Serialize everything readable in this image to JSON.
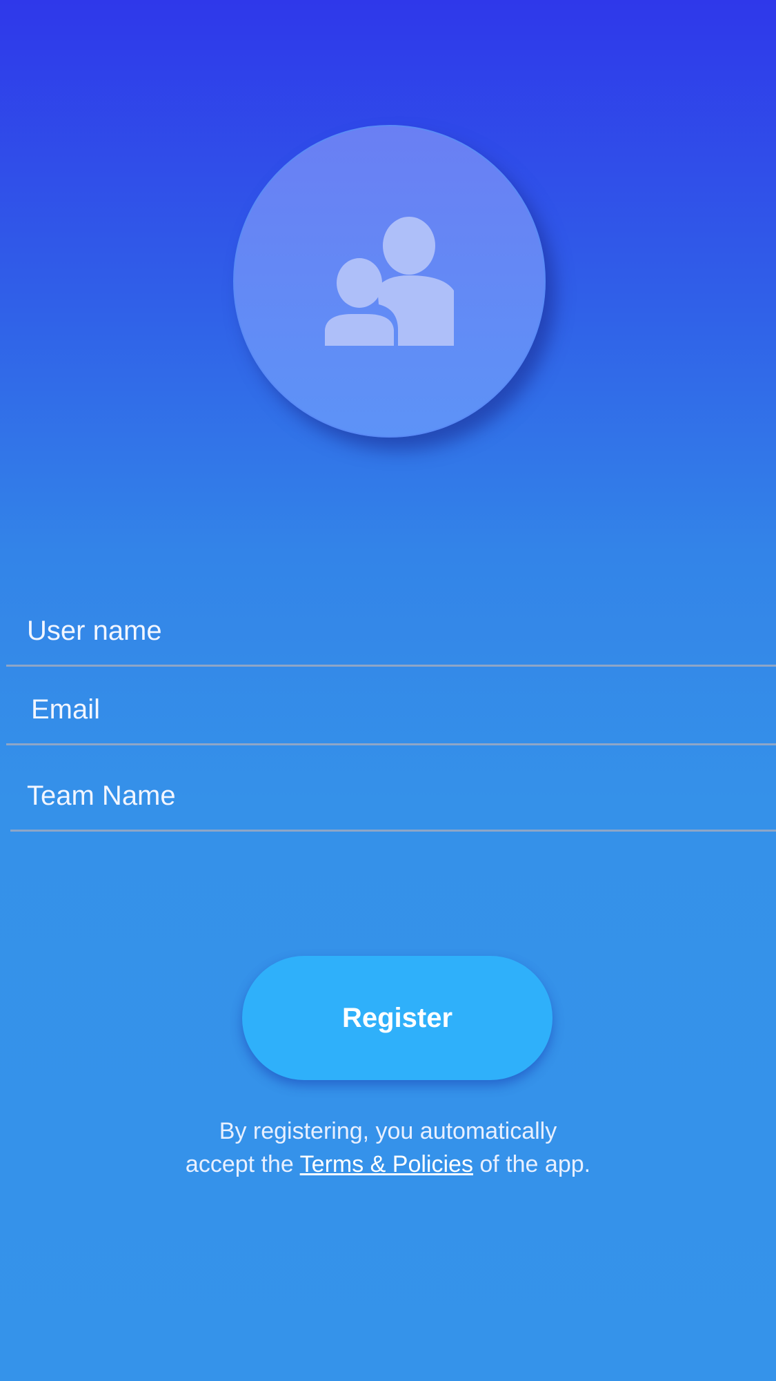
{
  "avatar": {
    "icon": "users-icon"
  },
  "form": {
    "username_placeholder": "User name",
    "email_placeholder": "Email",
    "team_placeholder": "Team Name"
  },
  "register_label": "Register",
  "terms": {
    "line1": "By registering, you automatically",
    "line2_prefix": "accept the",
    "link": "Terms & Policies",
    "line2_suffix": "of the app."
  },
  "colors": {
    "background_top": "#2f38ea",
    "background_bottom": "#3593ea",
    "button": "#2fb0fa",
    "avatar": "#6a7ff3"
  }
}
